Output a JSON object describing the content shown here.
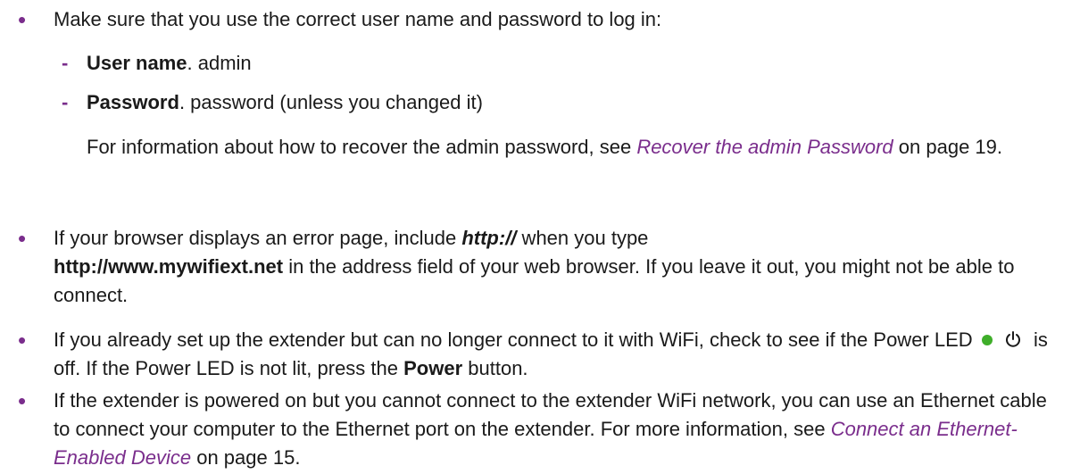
{
  "bullets": {
    "b1": "Make sure that you use the correct user name and password to log in:",
    "sub1_label": "User name",
    "sub1_text": ". admin",
    "sub2_label": "Password",
    "sub2_text": ". password (unless you changed it)",
    "recover_prefix": "For information about how to recover the admin password, see ",
    "recover_link": "Recover the admin Password",
    "recover_suffix": " on page 19.",
    "b2_part1": "If your browser displays an error page, include ",
    "b2_http": "http://",
    "b2_part2": " when you type ",
    "b2_url": "http://www.mywifiext.net",
    "b2_part3": " in the address field of your web browser. If you leave it out, you might not be able to connect.",
    "b3_part1": "If you already set up the extender but can no longer connect to it with WiFi, check to see if the Power LED",
    "b3_part2": "is off. If the Power LED is not lit, press the ",
    "b3_power": "Power",
    "b3_part3": " button.",
    "b4_part1": "If the extender is powered on but you cannot connect to the extender WiFi network, you can use an Ethernet cable to connect your computer to the Ethernet port on the extender. For more information, see ",
    "b4_link": "Connect an Ethernet-Enabled Device",
    "b4_part2": " on page 15."
  },
  "icons": {
    "led": "led-green-dot",
    "power": "power-icon"
  },
  "colors": {
    "accent": "#7a2d8c",
    "led": "#3fae2a"
  }
}
